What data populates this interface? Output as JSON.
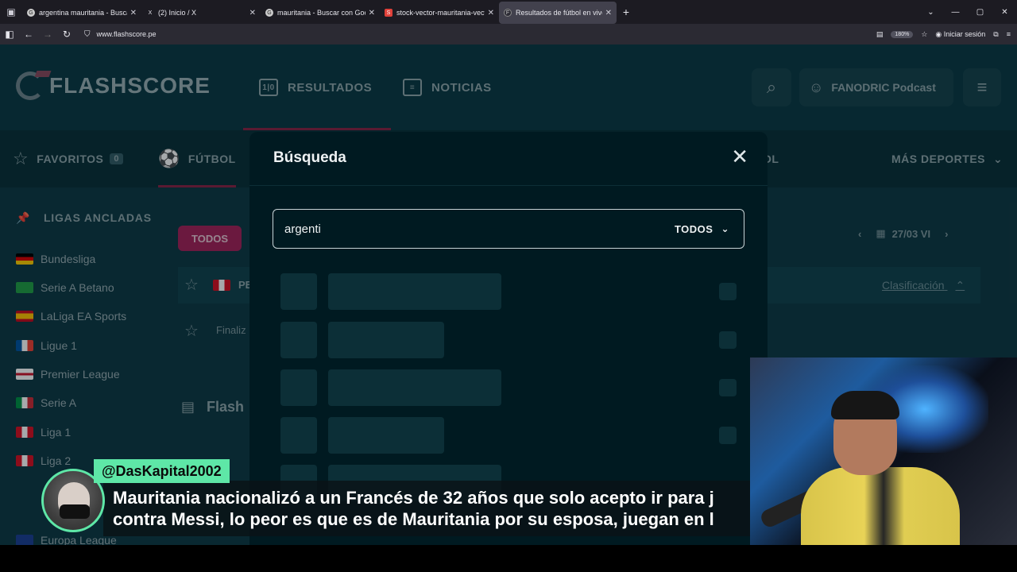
{
  "browser": {
    "tabs": [
      {
        "title": "argentina mauritania - Buscar c",
        "favicon": "G"
      },
      {
        "title": "(2) Inicio / X",
        "favicon": "X"
      },
      {
        "title": "mauritania - Buscar con Google",
        "favicon": "G"
      },
      {
        "title": "stock-vector-mauritania-vector",
        "favicon": "S"
      },
      {
        "title": "Resultados de fútbol en vivo, M",
        "favicon": "F"
      }
    ],
    "active_tab_index": 4,
    "url": "www.flashscore.pe",
    "zoom": "180%",
    "signin_label": "Iniciar sesión"
  },
  "site": {
    "logo_text": "FLASHSCORE",
    "nav": {
      "resultados": "RESULTADOS",
      "noticias": "NOTICIAS"
    },
    "user_label": "FANODRIC Podcast",
    "subnav": {
      "favoritos": "FAVORITOS",
      "favoritos_count": "0",
      "futbol": "FÚTBOL",
      "hidden_partial": "OL",
      "mas_deportes": "MÁS DEPORTES"
    },
    "sidebar": {
      "heading": "LIGAS ANCLADAS",
      "leagues": [
        {
          "name": "Bundesliga",
          "flag": "germany"
        },
        {
          "name": "Serie A Betano",
          "flag": "brazil"
        },
        {
          "name": "LaLiga EA Sports",
          "flag": "spain"
        },
        {
          "name": "Ligue 1",
          "flag": "france"
        },
        {
          "name": "Premier League",
          "flag": "england"
        },
        {
          "name": "Serie A",
          "flag": "italy"
        },
        {
          "name": "Liga 1",
          "flag": "peru"
        },
        {
          "name": "Liga 2",
          "flag": "peru"
        },
        {
          "name": "Europa League",
          "flag": "europe"
        }
      ]
    },
    "content": {
      "todos_label": "TODOS",
      "date_label": "27/03 VI",
      "row1_partial": "PE",
      "row2_partial": "Finaliz",
      "clasificacion": "Clasificación",
      "news_partial": "Flash"
    }
  },
  "modal": {
    "title": "Búsqueda",
    "search_value": "argenti",
    "filter_label": "TODOS"
  },
  "stream": {
    "handle": "@DasKapital2002",
    "line1": "Mauritania nacionalizó a un Francés de 32 años que solo acepto ir para j",
    "line2": "contra Messi, lo peor es que es de Mauritania por su esposa, juegan en l"
  }
}
